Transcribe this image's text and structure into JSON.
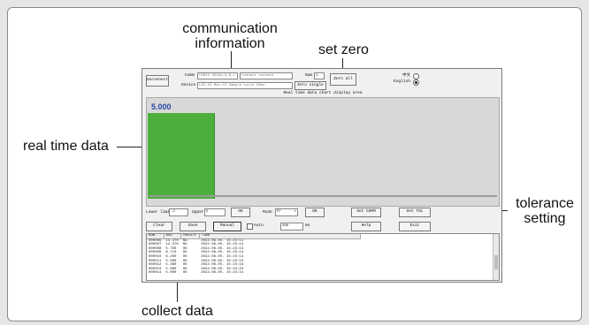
{
  "annotations": {
    "communication": "communication\ninformation",
    "set_zero": "set zero",
    "real_time": "real time data",
    "tolerance": "tolerance\nsetting",
    "collect": "collect data"
  },
  "app": {
    "disconnect_btn": "Unconnect",
    "com_label": "Comm",
    "device_label": "Device",
    "com_value": "COM13 38400,8,N,1",
    "com_status": "Connect succeed",
    "device_value": "LGS-15 Max:15 Sample cycle 50ms",
    "num_label": "Num",
    "num_value": "1",
    "zero_single": "Zero single",
    "zero_all": "Zero all",
    "lang_cn": "中文",
    "lang_en": "English",
    "chart_title": "Real time data chart display area",
    "realtime_value": "5.000",
    "lower_label": "Lower limit",
    "lower_value": "-2",
    "upper_label": "Upper",
    "upper_value": "5",
    "ok1": "OK",
    "mode_label": "Mode",
    "mode_value": "FF",
    "ok2": "OK",
    "set_comm": "Set COMM",
    "set_tol": "Set TOL",
    "clear": "Clear",
    "save": "Save",
    "manual": "Manual",
    "auto_label": "Auto",
    "interval": "200",
    "interval_unit": "ms",
    "help": "Help",
    "exit": "Exit"
  },
  "log": {
    "headers": [
      "Num",
      "Dat",
      "Result",
      "Time"
    ],
    "rows": [
      [
        "000006",
        "14.470",
        "NG",
        "2022-06-05. 15:23:11"
      ],
      [
        "000007",
        "14.370",
        "NG",
        "2022-06-05. 15:23:12"
      ],
      [
        "000008",
        "5.760",
        "OK",
        "2022-06-05. 15:23:13"
      ],
      [
        "000009",
        "6.710",
        "OK",
        "2022-06-05. 15:23:14"
      ],
      [
        "000010",
        "6.260",
        "OK",
        "2022-06-05. 15:23:14"
      ],
      [
        "000011",
        "5.590",
        "OK",
        "2022-06-05. 15:23:15"
      ],
      [
        "000012",
        "5.360",
        "OK",
        "2022-06-05. 15:23:16"
      ],
      [
        "000013",
        "5.080",
        "OK",
        "2022-06-05. 15:23:23"
      ],
      [
        "000014",
        "5.000",
        "OK",
        "2022-06-05. 15:23:31"
      ]
    ]
  }
}
